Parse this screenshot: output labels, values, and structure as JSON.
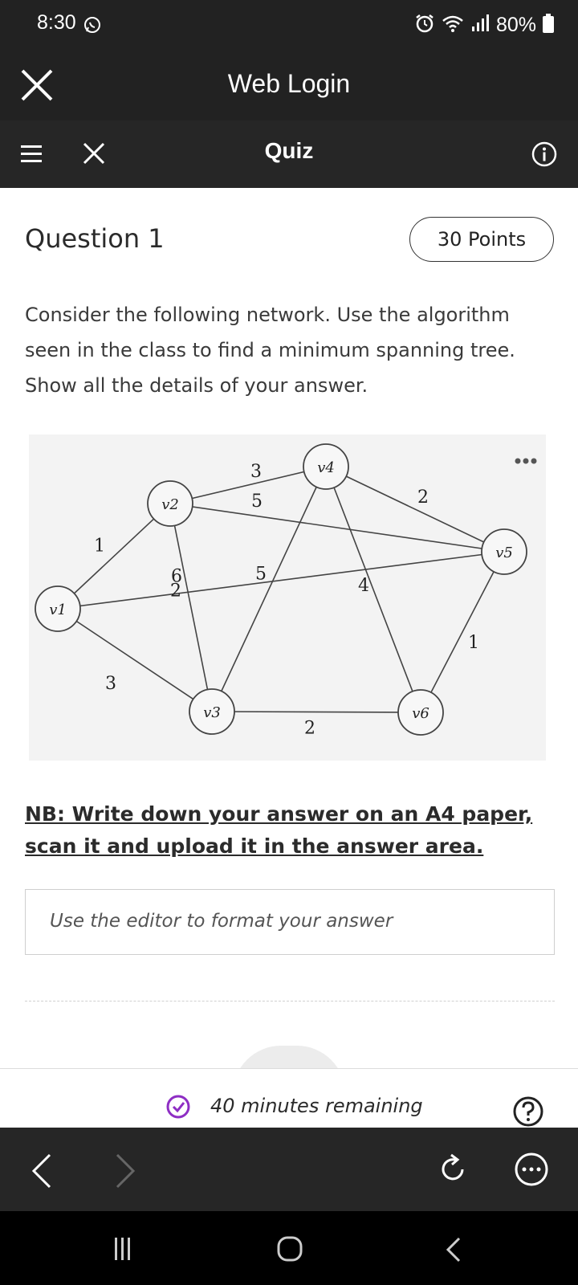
{
  "status_bar": {
    "time": "8:30",
    "battery": "80%",
    "icons": [
      "whatsapp-icon",
      "alarm-icon",
      "wifi-icon",
      "signal-icon",
      "battery-icon"
    ]
  },
  "web_header": {
    "title": "Web Login",
    "close_icon": "close-icon"
  },
  "quiz_header": {
    "title": "Quiz",
    "icons": [
      "menu-icon",
      "close-icon",
      "info-icon"
    ]
  },
  "question": {
    "heading": "Question 1",
    "points": "30 Points",
    "text": "Consider the following network. Use the algorithm seen in the class to find a minimum spanning tree. Show all the details of your answer.",
    "note": "NB: Write down your answer on an A4 paper, scan it and upload it in the answer area."
  },
  "graph": {
    "nodes": [
      {
        "id": "v1",
        "label": "v1"
      },
      {
        "id": "v2",
        "label": "v2"
      },
      {
        "id": "v3",
        "label": "v3"
      },
      {
        "id": "v4",
        "label": "v4"
      },
      {
        "id": "v5",
        "label": "v5"
      },
      {
        "id": "v6",
        "label": "v6"
      }
    ],
    "edges": [
      {
        "from": "v1",
        "to": "v2",
        "weight": "1"
      },
      {
        "from": "v1",
        "to": "v5",
        "weight": "6"
      },
      {
        "from": "v1",
        "to": "v3",
        "weight": "3"
      },
      {
        "from": "v2",
        "to": "v4",
        "weight": "3"
      },
      {
        "from": "v2",
        "to": "v5",
        "weight": "5"
      },
      {
        "from": "v2",
        "to": "v3",
        "weight": "2"
      },
      {
        "from": "v3",
        "to": "v4",
        "weight": "5"
      },
      {
        "from": "v3",
        "to": "v6",
        "weight": "2"
      },
      {
        "from": "v4",
        "to": "v5",
        "weight": "2"
      },
      {
        "from": "v4",
        "to": "v6",
        "weight": "4"
      },
      {
        "from": "v5",
        "to": "v6",
        "weight": "1"
      }
    ]
  },
  "editor": {
    "placeholder": "Use the editor to format your answer"
  },
  "timer": {
    "text": "40 minutes remaining"
  },
  "nav": {
    "icons": [
      "chevron-left-icon",
      "chevron-right-icon",
      "refresh-icon",
      "more-icon"
    ]
  },
  "colors": {
    "dark_bar": "#222222",
    "timer_icon": "#8e2ec4",
    "text": "#2b2b2b"
  }
}
